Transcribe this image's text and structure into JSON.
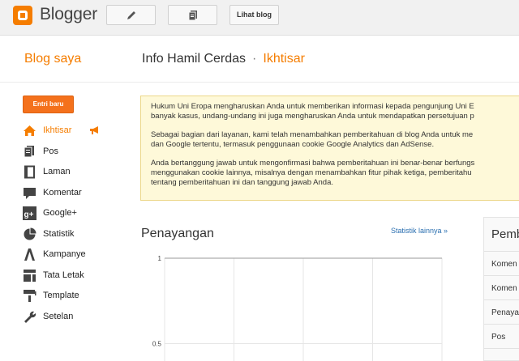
{
  "topbar": {
    "brand": "Blogger",
    "view_blog_label": "Lihat blog"
  },
  "header": {
    "my_blogs": "Blog saya",
    "blog_name": "Info Hamil Cerdas",
    "separator": "·",
    "current_page": "Ikhtisar"
  },
  "sidebar": {
    "new_post": "Entri baru",
    "items": [
      {
        "label": "Ikhtisar",
        "icon": "home-icon",
        "active": true
      },
      {
        "label": "Pos",
        "icon": "posts-icon"
      },
      {
        "label": "Laman",
        "icon": "page-icon"
      },
      {
        "label": "Komentar",
        "icon": "comment-icon"
      },
      {
        "label": "Google+",
        "icon": "google-plus-icon"
      },
      {
        "label": "Statistik",
        "icon": "pie-chart-icon"
      },
      {
        "label": "Kampanye",
        "icon": "adwords-icon"
      },
      {
        "label": "Tata Letak",
        "icon": "layout-icon"
      },
      {
        "label": "Template",
        "icon": "paint-roller-icon"
      },
      {
        "label": "Setelan",
        "icon": "wrench-icon"
      }
    ]
  },
  "notice": {
    "p1_line1": "Hukum Uni Eropa mengharuskan Anda untuk memberikan informasi kepada pengunjung Uni E",
    "p1_line2": "banyak kasus, undang-undang ini juga mengharuskan Anda untuk mendapatkan persetujuan p",
    "p2_line1": "Sebagai bagian dari layanan, kami telah menambahkan pemberitahuan di blog Anda untuk me",
    "p2_line2": "dan Google tertentu, termasuk penggunaan cookie Google Analytics dan AdSense.",
    "p3_line1": "Anda bertanggung jawab untuk mengonfirmasi bahwa pemberitahuan ini benar-benar berfungs",
    "p3_line2": "menggunakan cookie lainnya, misalnya dengan menambahkan fitur pihak ketiga, pemberitahu",
    "p3_line3": "tentang pemberitahuan ini dan tanggung jawab Anda."
  },
  "stats": {
    "title": "Penayangan",
    "more_link": "Statistik lainnya »"
  },
  "chart_data": {
    "type": "line",
    "series": [],
    "yticks": [
      "1",
      "0.5"
    ],
    "ylim": [
      0,
      1
    ],
    "grid": true,
    "xlabel": "",
    "ylabel": ""
  },
  "right_panel": {
    "title": "Pemb",
    "items": [
      "Komen",
      "Komen",
      "Penaya",
      "Pos"
    ]
  },
  "colors": {
    "accent": "#f57d00",
    "button": "#f4711c",
    "notice_bg": "#fef9d9",
    "link": "#2a6fb0"
  }
}
